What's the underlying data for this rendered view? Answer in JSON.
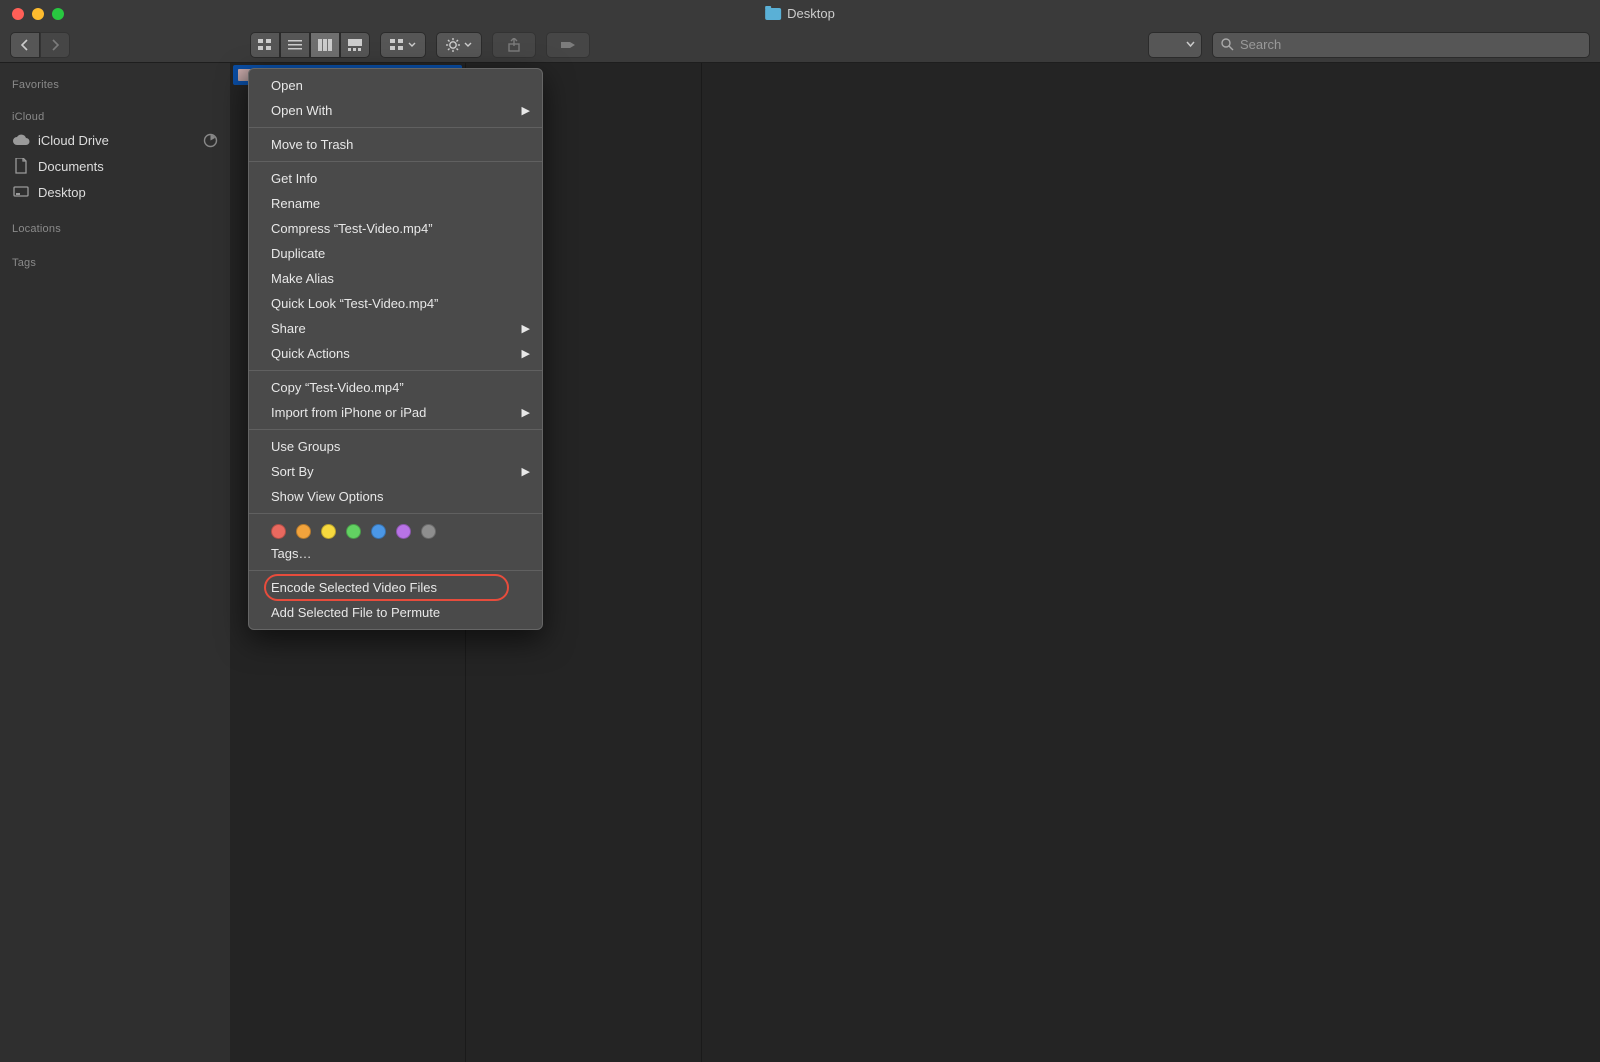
{
  "window": {
    "title": "Desktop"
  },
  "search": {
    "placeholder": "Search"
  },
  "sidebar": {
    "sections": [
      {
        "title": "Favorites",
        "items": []
      },
      {
        "title": "iCloud",
        "items": [
          {
            "label": "iCloud Drive",
            "icon": "cloud",
            "trailing": "pie"
          },
          {
            "label": "Documents",
            "icon": "doc"
          },
          {
            "label": "Desktop",
            "icon": "desktop"
          }
        ]
      },
      {
        "title": "Locations",
        "items": []
      },
      {
        "title": "Tags",
        "items": []
      }
    ]
  },
  "file": {
    "name": "Test-Video.mp4"
  },
  "context_menu": {
    "groups": [
      [
        {
          "label": "Open"
        },
        {
          "label": "Open With",
          "submenu": true
        }
      ],
      [
        {
          "label": "Move to Trash"
        }
      ],
      [
        {
          "label": "Get Info"
        },
        {
          "label": "Rename"
        },
        {
          "label": "Compress “Test-Video.mp4”"
        },
        {
          "label": "Duplicate"
        },
        {
          "label": "Make Alias"
        },
        {
          "label": "Quick Look “Test-Video.mp4”"
        },
        {
          "label": "Share",
          "submenu": true
        },
        {
          "label": "Quick Actions",
          "submenu": true
        }
      ],
      [
        {
          "label": "Copy “Test-Video.mp4”"
        },
        {
          "label": "Import from iPhone or iPad",
          "submenu": true
        }
      ],
      [
        {
          "label": "Use Groups"
        },
        {
          "label": "Sort By",
          "submenu": true
        },
        {
          "label": "Show View Options"
        }
      ]
    ],
    "tag_colors": [
      "#e9695f",
      "#f2a33c",
      "#f7d93e",
      "#62d162",
      "#4b97e6",
      "#b873e6",
      "#8e8e8e"
    ],
    "tags_label": "Tags…",
    "footer": [
      {
        "label": "Encode Selected Video Files",
        "highlight": true
      },
      {
        "label": "Add Selected File to Permute"
      }
    ]
  }
}
